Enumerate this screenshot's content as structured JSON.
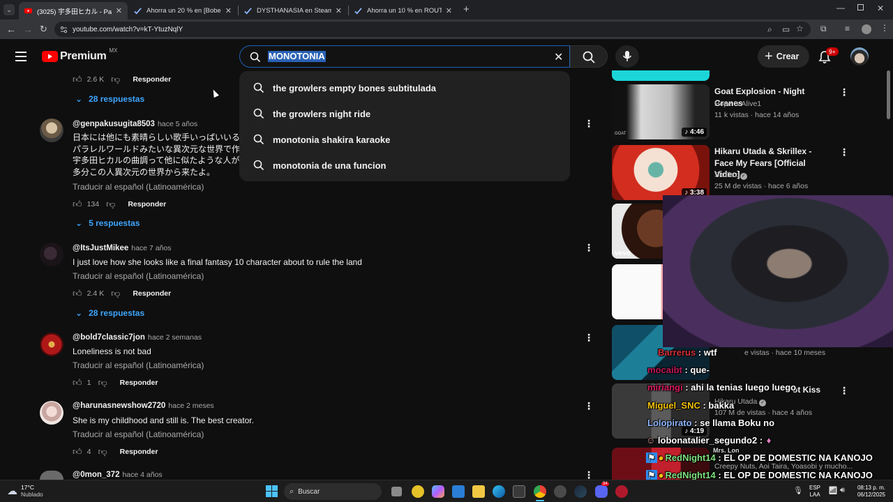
{
  "browser": {
    "tabs": [
      {
        "title": "(3025) 宇多田ヒカル - Passion ~",
        "active": true
      },
      {
        "title": "Ahorra un 20 % en [Bober Bros]",
        "active": false
      },
      {
        "title": "DYSTHANASIA en Steam",
        "active": false
      },
      {
        "title": "Ahorra un 10 % en ROUTINE en",
        "active": false
      }
    ],
    "url": "youtube.com/watch?v=kT-YtuzNqlY"
  },
  "header": {
    "logo_text": "Premium",
    "region": "MX",
    "search_value": "MONOTONIA",
    "create_label": "Crear",
    "notif_badge": "9+"
  },
  "suggestions": [
    "the growlers empty bones subtitulada",
    "the growlers night ride",
    "monotonia shakira karaoke",
    "monotonia de una funcion"
  ],
  "top_actions": {
    "likes": "2.6 K",
    "reply": "Responder",
    "replies": "28 respuestas"
  },
  "comments": [
    {
      "handle": "@genpakusugita8503",
      "time": "hace 5 años",
      "lines": [
        "日本には他にも素晴らしい歌手いっぱいいるけ",
        "パラレルワールドみたいな異次元な世界で作ら",
        "宇多田ヒカルの曲調って他に似たような人がい",
        "多分この人異次元の世界から来たよ。"
      ],
      "translate": "Traducir al español (Latinoamérica)",
      "likes": "134",
      "reply": "Responder",
      "replies": "5 respuestas"
    },
    {
      "handle": "@ItsJustMikee",
      "time": "hace 7 años",
      "lines": [
        "I just love how she looks like a  final fantasy 10 character about to rule the land"
      ],
      "translate": "Traducir al español (Latinoamérica)",
      "likes": "2.4 K",
      "reply": "Responder",
      "replies": "28 respuestas"
    },
    {
      "handle": "@bold7classic7jon",
      "time": "hace 2 semanas",
      "lines": [
        "Loneliness is not bad"
      ],
      "translate": "Traducir al español (Latinoamérica)",
      "likes": "1",
      "reply": "Responder"
    },
    {
      "handle": "@harunasnewshow2720",
      "time": "hace 2 meses",
      "lines": [
        "She is my childhood and still is. The best creator."
      ],
      "translate": "Traducir al español (Latinoamérica)",
      "likes": "4",
      "reply": "Responder"
    },
    {
      "handle": "@0mon_372",
      "time": "hace 4 años"
    }
  ],
  "sidebar": {
    "videos": [
      {
        "title": "Goat Explosion - Night Cranes",
        "channel": "Hope Is Alive1",
        "meta": "11 k vistas · hace 14 años",
        "duration": "4:46",
        "thumb_label": "GOAT"
      },
      {
        "title": "Hikaru Utada & Skrillex - Face My Fears [Official Video]",
        "channel": "Skrillex",
        "meta": "25 M de vistas · hace 6 años",
        "duration": "3:38"
      },
      {
        "thumb_label": "vevo"
      },
      {},
      {
        "meta": "e vistas · hace 10 meses"
      },
      {
        "title": "ot Kiss",
        "channel": "Hikaru Utada",
        "meta": "107 M de vistas · hace 4 años",
        "duration": "4:19"
      },
      {
        "channel": "Creepy Nuts, Aoi Taira, Yoasobi y mucho..."
      }
    ]
  },
  "chat": [
    {
      "user": "Barrerus",
      "msg": "wtf",
      "color": "#d32f3a"
    },
    {
      "user": "mocaibt",
      "msg": "que-",
      "color": "#c2185b"
    },
    {
      "user": "miriangi",
      "msg": "ahi la tenias luego luego",
      "color": "#d81b60"
    },
    {
      "user": "Miguel_SNC",
      "msg": "bakka",
      "color": "#f4c20d"
    },
    {
      "user": "Lolopirato",
      "msg": "se llama Boku no",
      "color": "#8fb8ff"
    },
    {
      "user": "lobonatalier_segundo2",
      "msg": "",
      "color": "#f1f1f1"
    },
    {
      "user": "RedNight14",
      "msg": "EL OP DE DOMESTIC NA KANOJO",
      "color": "#7fe07f"
    },
    {
      "user": "RedNight14",
      "msg": "EL OP DE DOMESTIC NA KANOJO",
      "color": "#7fe07f"
    },
    {
      "user": "",
      "msg": "Mrs. Lon",
      "color": "#f1f1f1"
    }
  ],
  "taskbar": {
    "weather_temp": "17°C",
    "weather_desc": "Nublado",
    "search_label": "Buscar",
    "lang_top": "ESP",
    "lang_bottom": "LAA",
    "time": "08:13 p. m.",
    "date": "06/12/2025",
    "discord_badge": "34"
  }
}
